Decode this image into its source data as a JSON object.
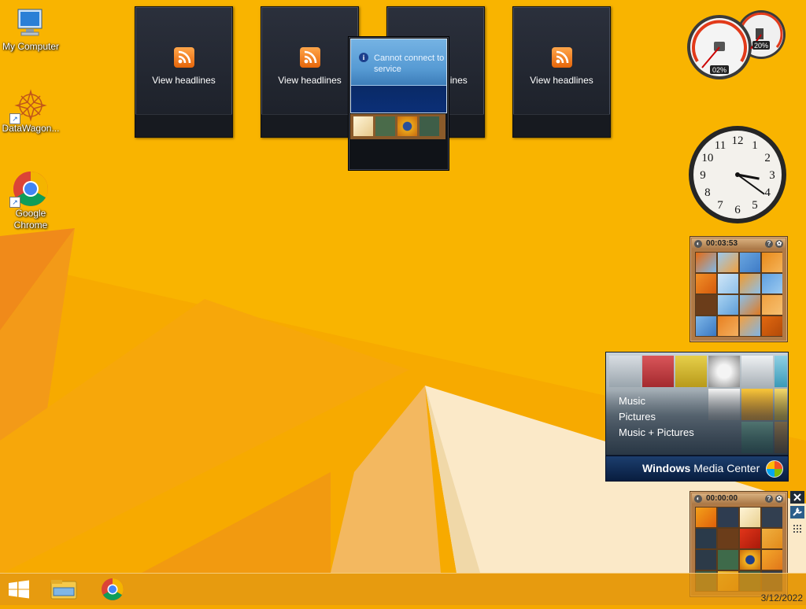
{
  "desktop": {
    "icons": [
      {
        "label": "My Computer"
      },
      {
        "label": "DataWagon..."
      },
      {
        "label": "Google Chrome"
      }
    ]
  },
  "headlines": {
    "items": [
      {
        "label": "View headlines"
      },
      {
        "label": "View headlines"
      },
      {
        "label": "View headlines"
      },
      {
        "label": "View headlines"
      }
    ]
  },
  "slideshow": {
    "message": "Cannot connect to service",
    "icon": "info-icon"
  },
  "meter": {
    "cpu_label": "02%",
    "memory_label": "20%",
    "cpu_value": 0.02,
    "memory_value": 0.2
  },
  "clock": {
    "numerals": [
      "12",
      "1",
      "2",
      "3",
      "4",
      "5",
      "6",
      "7",
      "8",
      "9",
      "10",
      "11"
    ],
    "hour": 3,
    "minute": 21
  },
  "puzzle_top": {
    "timer": "00:03:53"
  },
  "puzzle_bottom": {
    "timer": "00:00:00"
  },
  "media_center": {
    "menu": [
      "Music",
      "Pictures",
      "Music + Pictures"
    ],
    "brand_bold": "Windows",
    "brand_light": " Media Center"
  },
  "taskbar": {
    "date": "3/12/2022",
    "colors": {
      "accent": "#f5a800",
      "taskbar": "#e2961a"
    }
  },
  "icons": {
    "start": "windows-logo-icon",
    "explorer": "file-explorer-icon",
    "chrome": "chrome-icon"
  }
}
